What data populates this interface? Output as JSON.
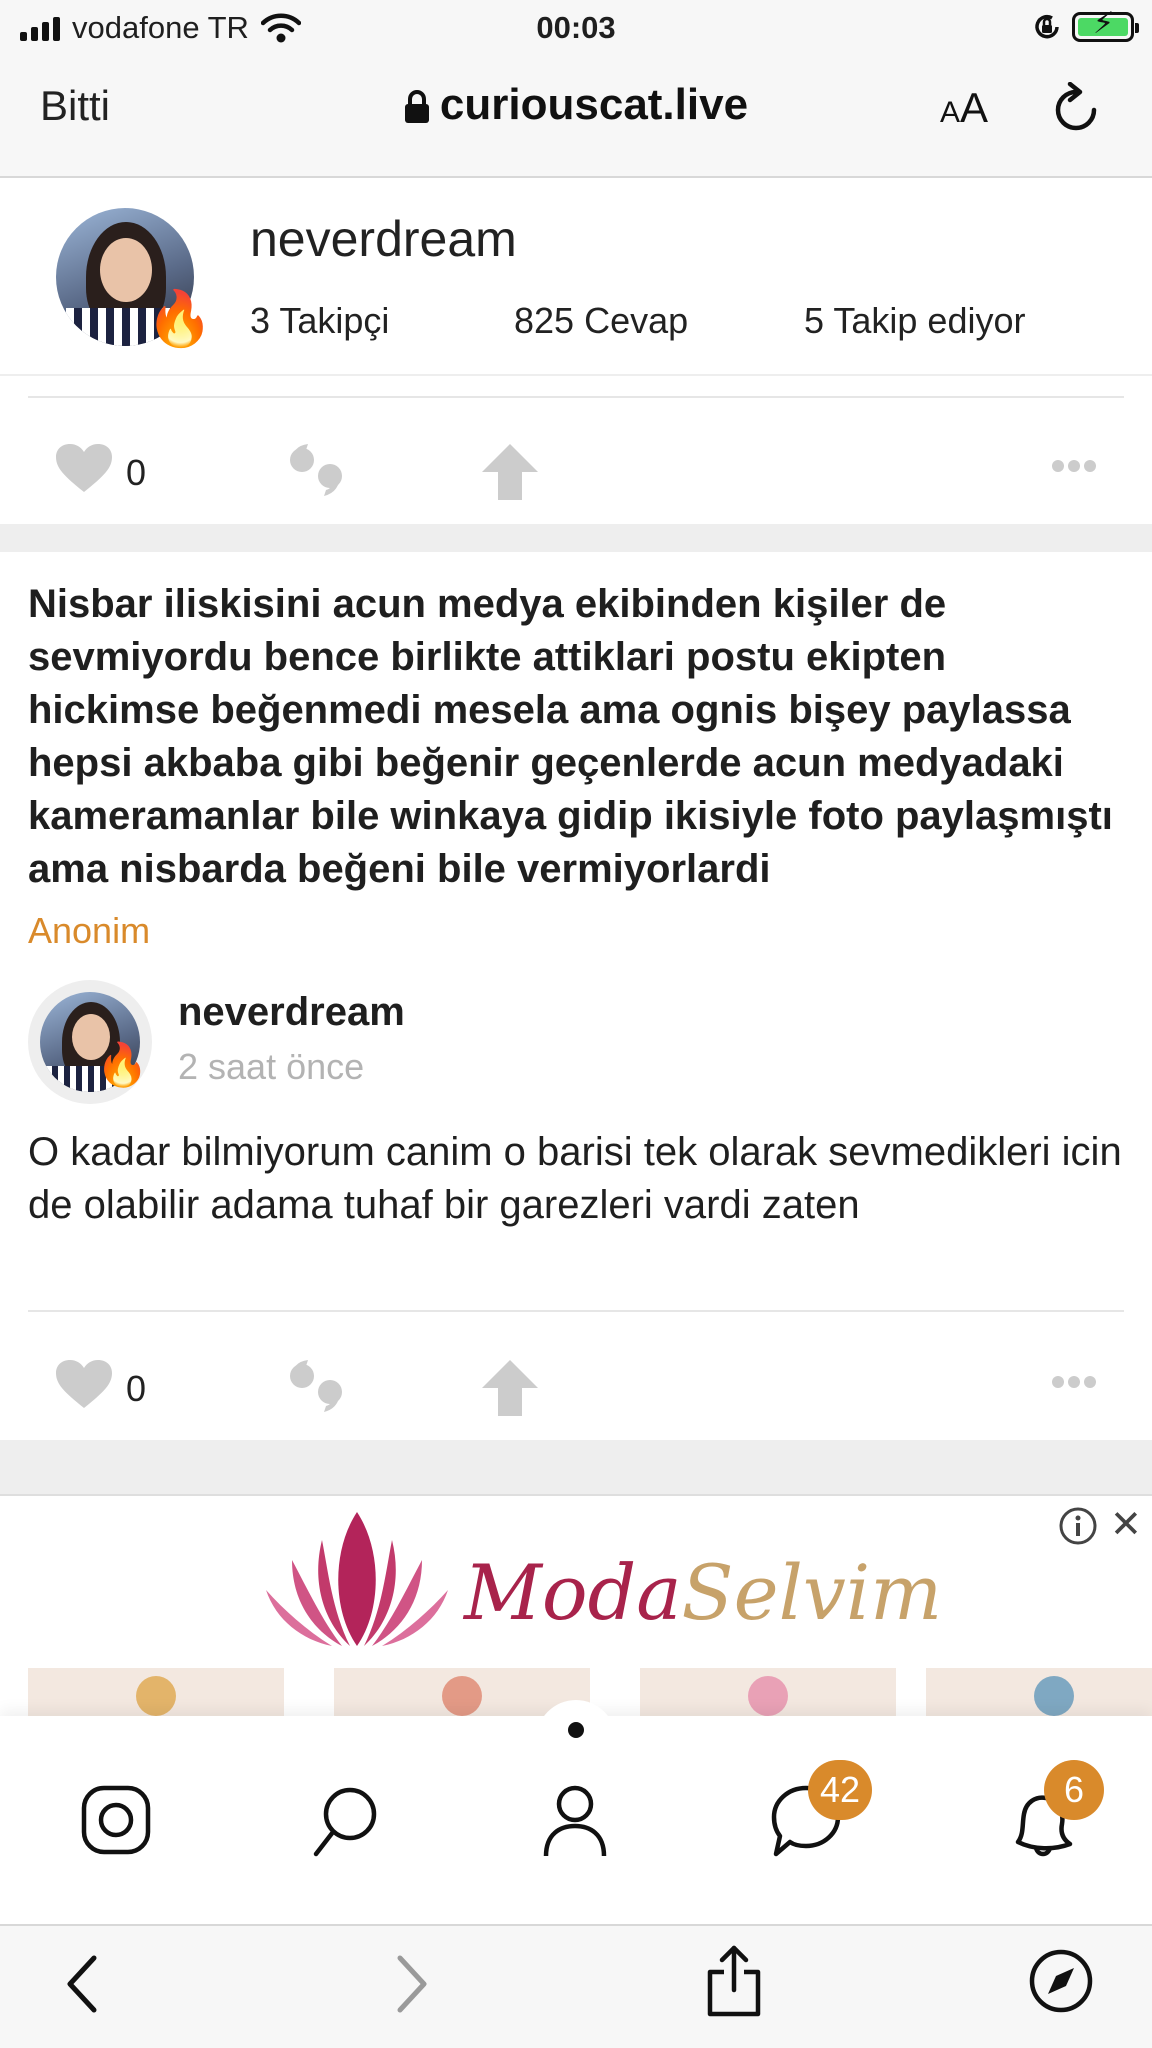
{
  "status_bar": {
    "carrier": "vodafone TR",
    "time": "00:03"
  },
  "browser": {
    "done_label": "Bitti",
    "url": "curiouscat.live",
    "text_size_small": "A",
    "text_size_large": "A"
  },
  "profile": {
    "username": "neverdream",
    "followers": "3 Takipçi",
    "answers": "825 Cevap",
    "following": "5 Takip ediyor"
  },
  "post_top": {
    "like_count": "0"
  },
  "post": {
    "question": "Nisbar iliskisini acun medya ekibinden kişiler de sevmiyordu bence birlikte attiklari postu ekipten hickimse beğenmedi mesela ama ognis bişey paylassa hepsi akbaba gibi beğenir geçenlerde acun medyadaki kameramanlar bile winkaya gidip ikisiyle foto paylaşmıştı ama nisbarda beğeni bile vermiyorlardi",
    "asker": "Anonim",
    "answerer": "neverdream",
    "time_ago": "2 saat önce",
    "answer": "O kadar bilmiyorum canim o barisi tek olarak sevmedikleri icin de olabilir adama tuhaf bir garezleri vardi zaten",
    "like_count": "0"
  },
  "ad": {
    "brand_part1": "Moda",
    "brand_part2": "Selvim"
  },
  "site_nav": {
    "messages_badge": "42",
    "notifications_badge": "6"
  },
  "colors": {
    "accent": "#d98a2b",
    "ad_brand": "#a8234b",
    "ad_brand_gold": "#c7a26a",
    "icon_gray": "#cccccc"
  }
}
